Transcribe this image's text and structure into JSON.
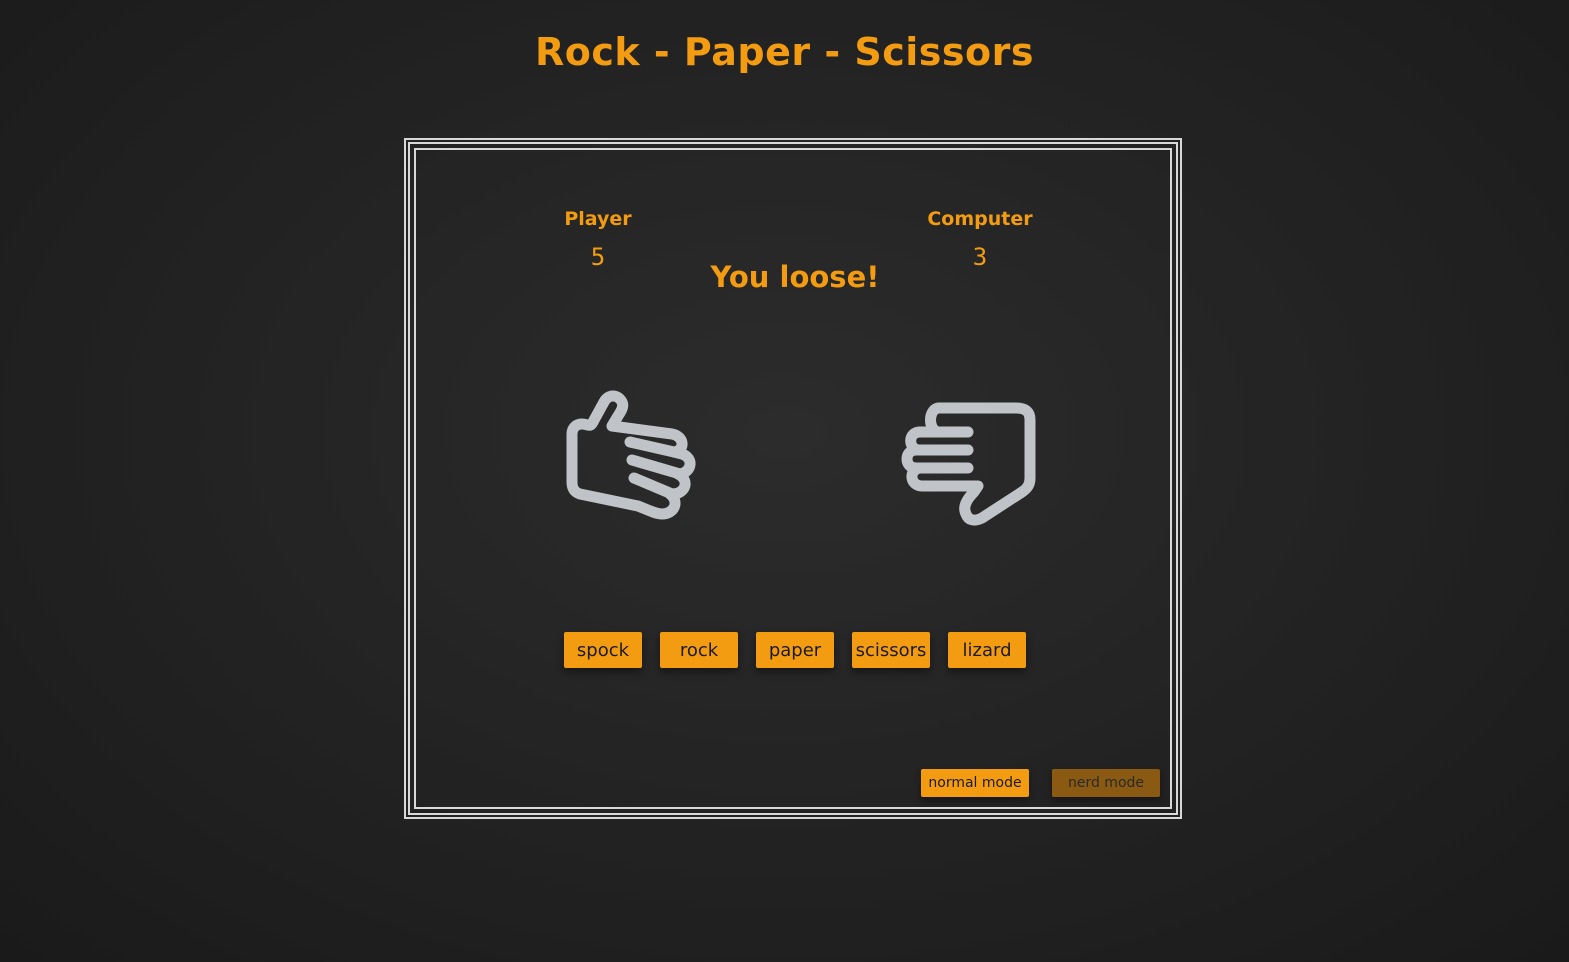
{
  "title": "Rock - Paper - Scissors",
  "player": {
    "label": "Player",
    "score": "5"
  },
  "computer": {
    "label": "Computer",
    "score": "3"
  },
  "result": "You loose!",
  "player_hand_icon": "paper-hand-icon",
  "computer_hand_icon": "paper-hand-icon",
  "choices": [
    "spock",
    "rock",
    "paper",
    "scissors",
    "lizard"
  ],
  "modes": {
    "normal": "normal mode",
    "nerd": "nerd mode"
  },
  "colors": {
    "accent": "#f39c12",
    "accent_dim": "#8a5a12",
    "hand": "#c0c4c8",
    "background": "#262626",
    "frame": "#d8d8d8"
  }
}
